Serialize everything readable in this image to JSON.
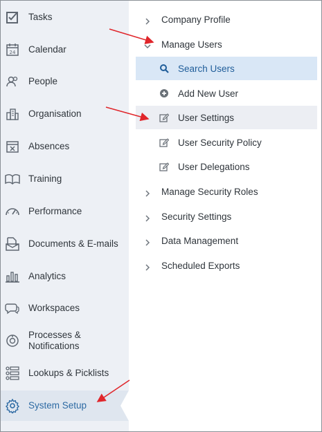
{
  "sidebar": {
    "items": [
      {
        "label": "Tasks",
        "icon": "checkbox-icon"
      },
      {
        "label": "Calendar",
        "icon": "calendar-icon"
      },
      {
        "label": "People",
        "icon": "people-icon"
      },
      {
        "label": "Organisation",
        "icon": "organisation-icon"
      },
      {
        "label": "Absences",
        "icon": "absences-icon"
      },
      {
        "label": "Training",
        "icon": "book-icon"
      },
      {
        "label": "Performance",
        "icon": "gauge-icon"
      },
      {
        "label": "Documents & E-mails",
        "icon": "documents-icon"
      },
      {
        "label": "Analytics",
        "icon": "bar-chart-icon"
      },
      {
        "label": "Workspaces",
        "icon": "chat-icon"
      },
      {
        "label": "Processes &",
        "label2": "Notifications",
        "icon": "processes-icon"
      },
      {
        "label": "Lookups & Picklists",
        "icon": "list-icon"
      },
      {
        "label": "System Setup",
        "icon": "gear-icon",
        "active": true
      }
    ]
  },
  "menu": {
    "company_profile": "Company Profile",
    "manage_users": "Manage Users",
    "search_users": "Search Users",
    "add_new_user": "Add New User",
    "user_settings": "User Settings",
    "user_security_policy": "User Security Policy",
    "user_delegations": "User Delegations",
    "manage_security_roles": "Manage Security Roles",
    "security_settings": "Security Settings",
    "data_management": "Data Management",
    "scheduled_exports": "Scheduled Exports"
  },
  "colors": {
    "sidebar_bg": "#edf0f5",
    "active_accent": "#2d6aa3",
    "selected_row_bg": "#d9e7f6",
    "annotation_arrow": "#e0262b"
  }
}
